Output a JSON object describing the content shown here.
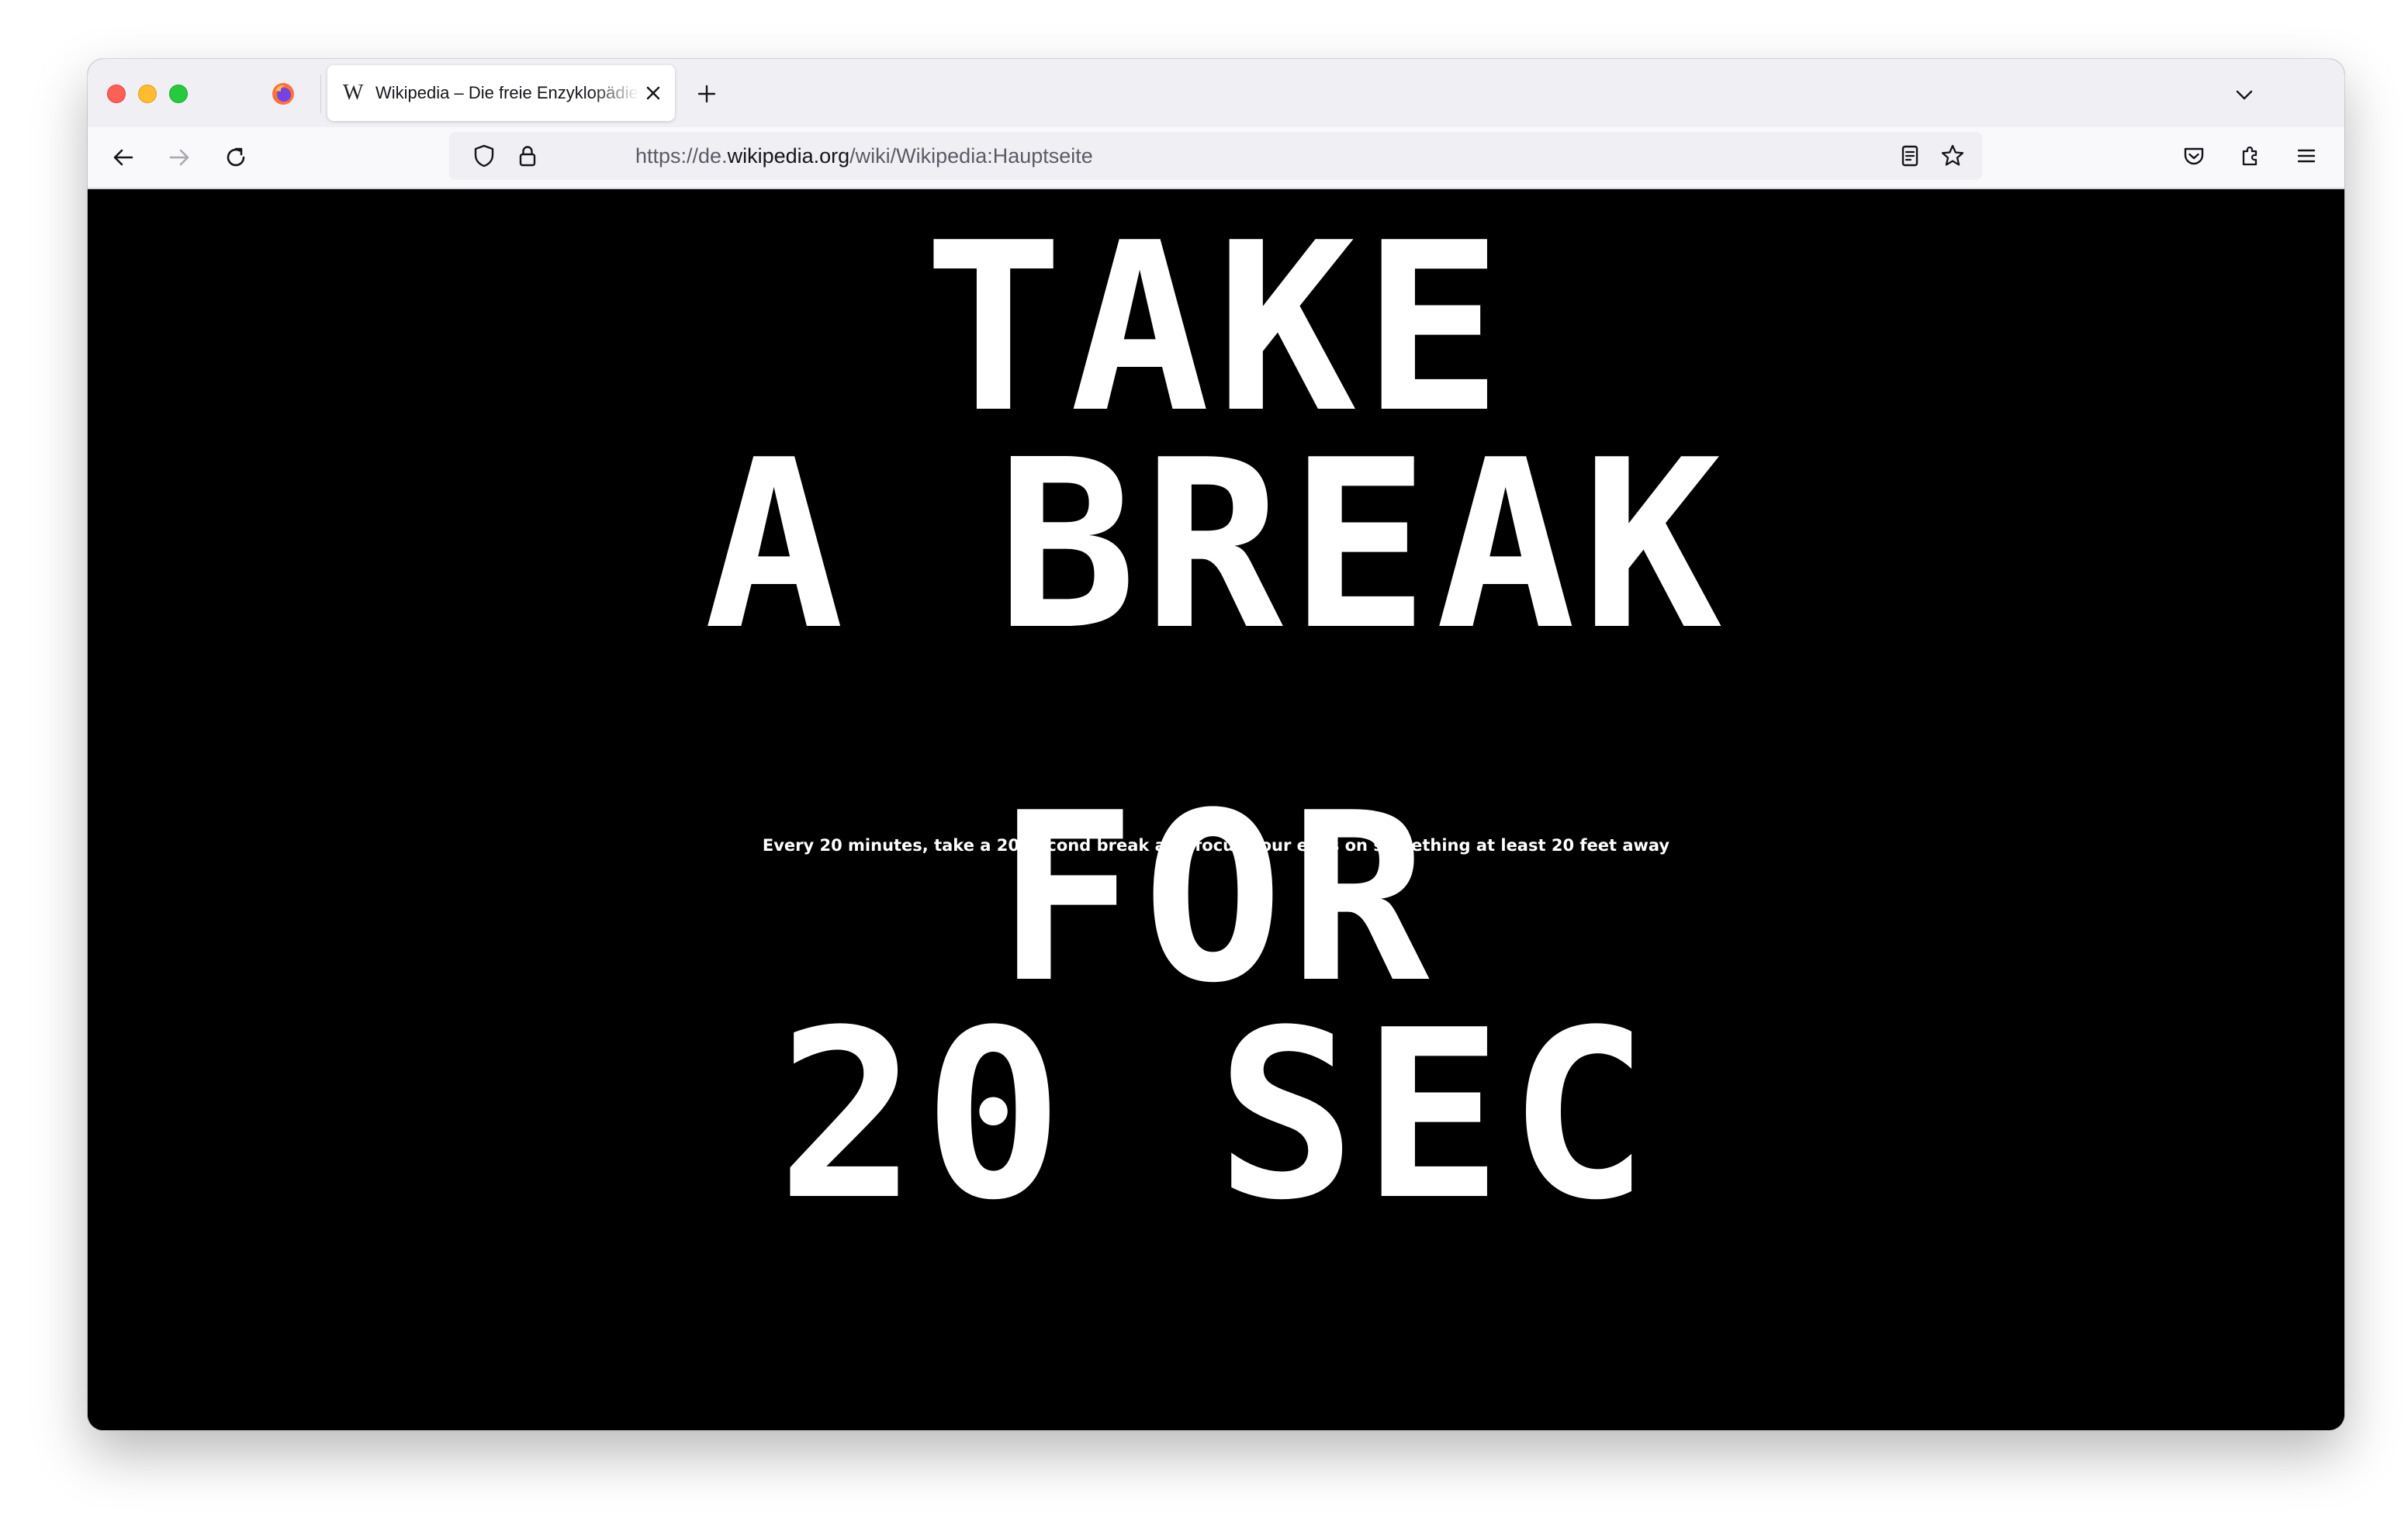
{
  "browser": {
    "tab": {
      "favicon": "W",
      "title": "Wikipedia – Die freie Enzyklopädie"
    },
    "url": {
      "scheme": "https://de.",
      "domain": "wikipedia.org",
      "path": "/wiki/Wikipedia:Hauptseite"
    },
    "icons": {
      "back": "arrow-left-icon",
      "forward": "arrow-right-icon",
      "reload": "reload-icon",
      "shield": "tracking-protection-shield-icon",
      "lock": "lock-icon",
      "reader": "reader-view-icon",
      "bookmark": "bookmark-star-icon",
      "pocket": "pocket-icon",
      "extensions": "extensions-puzzle-icon",
      "menu": "hamburger-menu-icon",
      "new_tab": "plus-icon",
      "tab_list": "chevron-down-icon",
      "tab_close": "close-icon"
    }
  },
  "page": {
    "line1": "TAKE",
    "line2": "A BREAK",
    "subtitle": "Every 20 minutes, take a 20-second break and focus your eyes on something at least 20 feet away",
    "line3": "FOR",
    "line4": "20 SEC"
  },
  "colors": {
    "background": "#000000",
    "text": "#ffffff",
    "chrome": "#f0f0f4"
  }
}
